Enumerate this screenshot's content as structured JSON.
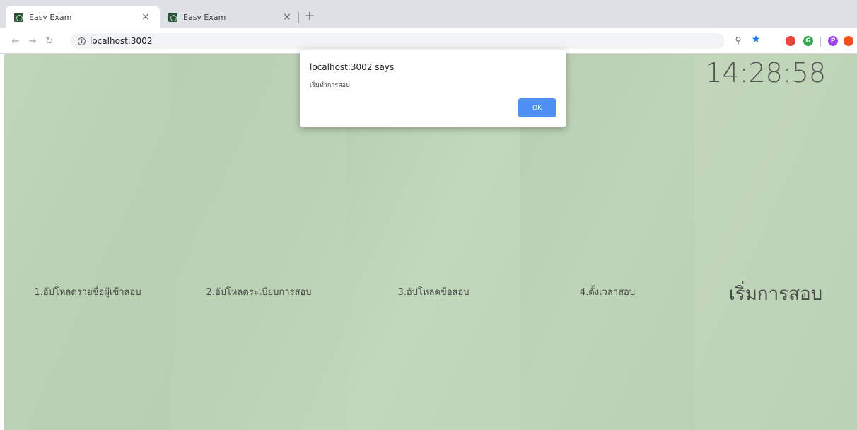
{
  "browser": {
    "tabs": [
      {
        "title": "Easy Exam",
        "active": true
      },
      {
        "title": "Easy Exam",
        "active": false
      }
    ],
    "close_glyph": "×",
    "new_tab_glyph": "+",
    "url": "localhost:3002",
    "toolbar_icons": [
      "key-icon",
      "star-icon",
      "red-extension-icon",
      "green-extension-icon",
      "profile-avatar",
      "orange-extension-icon"
    ],
    "avatar_letter": "P",
    "extension_letter": "G"
  },
  "page": {
    "background": "#bdd3b5",
    "clock": "14:28:58",
    "columns": [
      {
        "label": "1.อัปโหลดรายชื่อผู้เข้าสอบ"
      },
      {
        "label": "2.อัปโหลดระเบียบการสอบ"
      },
      {
        "label": "3.อัปโหลดข้อสอบ"
      },
      {
        "label": "4.ตั้งเวลาสอบ"
      },
      {
        "label": "เริ่มการสอบ"
      }
    ]
  },
  "dialog": {
    "title": "localhost:3002 says",
    "message": "เริ่มทำการสอบ",
    "ok_label": "OK"
  },
  "colors": {
    "dialog_button": "#4d8ff5",
    "star": "#1a73e8"
  }
}
